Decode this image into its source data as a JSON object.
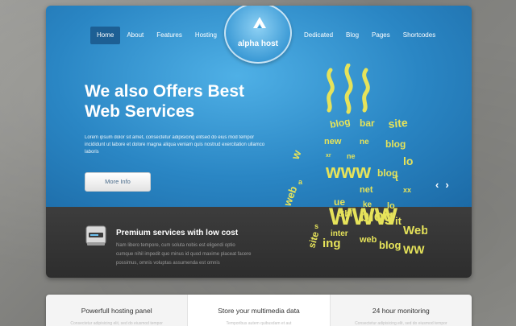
{
  "nav": {
    "left": [
      {
        "label": "Home",
        "active": true
      },
      {
        "label": "About"
      },
      {
        "label": "Features"
      },
      {
        "label": "Hosting"
      }
    ],
    "right": [
      {
        "label": "Dedicated"
      },
      {
        "label": "Blog"
      },
      {
        "label": "Pages"
      },
      {
        "label": "Shortcodes"
      }
    ]
  },
  "logo": {
    "text": "alpha host"
  },
  "hero": {
    "headline_line1": "We also Offers Best",
    "headline_line2": "Web Services",
    "lead": "Lorem ipsum dolor sit amet, consectetur adipisicing elitsed do eius mod tempor incididunt ut labore et dolore magna aliqua veniam quis nostrud exercitation ullamco laboris",
    "button": "More Info"
  },
  "feature": {
    "title": "Premium services with low cost",
    "text": "Nam libero tempore, cum soluta nobis est eligendi optio cumque nihil impedit quo minus id quod maxime placeat facere possimus, omnis voluptas assumenda est omnis"
  },
  "mug": {
    "words": [
      "blog",
      "bar",
      "site",
      "w",
      "new",
      "ne",
      "blog",
      "xr",
      "ne",
      "www",
      "blog",
      "lo",
      "a",
      "web",
      "net",
      "ue",
      "WWW",
      "xx",
      "blog",
      "s",
      "it",
      "lo",
      "web",
      "site",
      "ing",
      "blog",
      "Web",
      "WW",
      "inter",
      "Sbl",
      "ke",
      "t"
    ]
  },
  "cards": [
    {
      "title": "Powerfull hosting panel",
      "text": "Consectetur adipisicing elit, sed do eiusmod tempor"
    },
    {
      "title": "Store your multimedia data",
      "text": "Temporibus autem quibusdam et aut"
    },
    {
      "title": "24 hour monitoring",
      "text": "Consectetur adipisicing elit, sed do eiusmod tempor"
    }
  ],
  "colors": {
    "accent": "#2a86c4",
    "mug": "#e6e35a",
    "steam": "#e6e35a"
  }
}
